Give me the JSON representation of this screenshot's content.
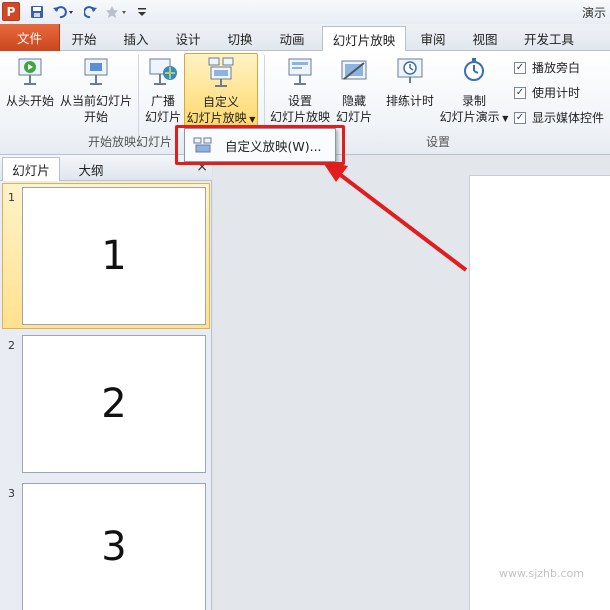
{
  "titlebar": {
    "app_logo": "P",
    "title": "演示"
  },
  "tabs": [
    {
      "id": "file",
      "label": "文件"
    },
    {
      "id": "home",
      "label": "开始"
    },
    {
      "id": "insert",
      "label": "插入"
    },
    {
      "id": "design",
      "label": "设计"
    },
    {
      "id": "transitions",
      "label": "切换"
    },
    {
      "id": "animations",
      "label": "动画"
    },
    {
      "id": "slideshow",
      "label": "幻灯片放映"
    },
    {
      "id": "review",
      "label": "审阅"
    },
    {
      "id": "view",
      "label": "视图"
    },
    {
      "id": "developer",
      "label": "开发工具"
    }
  ],
  "ribbon": {
    "from_beginning": "从头开始",
    "from_current_1": "从当前幻灯片",
    "from_current_2": "开始",
    "broadcast_1": "广播",
    "broadcast_2": "幻灯片",
    "custom_1": "自定义",
    "custom_2": "幻灯片放映",
    "setup_1": "设置",
    "setup_2": "幻灯片放映",
    "hide_1": "隐藏",
    "hide_2": "幻灯片",
    "rehearse": "排练计时",
    "record_1": "录制",
    "record_2": "幻灯片演示",
    "group_start": "开始放映幻灯片",
    "group_setup": "设置",
    "chk_narration": "播放旁白",
    "chk_timings": "使用计时",
    "chk_media": "显示媒体控件"
  },
  "dropdown": {
    "item": "自定义放映(W)..."
  },
  "left_pane": {
    "tab_slides": "幻灯片",
    "tab_outline": "大纲",
    "close": "×",
    "thumbs": [
      {
        "num": "1",
        "text": "1"
      },
      {
        "num": "2",
        "text": "2"
      },
      {
        "num": "3",
        "text": "3"
      }
    ]
  },
  "watermark": "www.sjzhb.com",
  "colors": {
    "accent": "#d24726",
    "highlight": "#e11d1d",
    "selected": "#ffe190"
  }
}
